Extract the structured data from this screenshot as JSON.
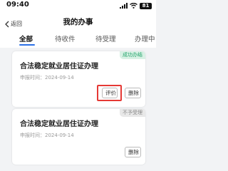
{
  "status_bar": {
    "time": "09:40",
    "battery": "81",
    "icons": [
      "signal-icon",
      "wifi-icon",
      "battery-icon"
    ]
  },
  "nav": {
    "back_label": "返回",
    "title": "我的办事"
  },
  "tabs": [
    {
      "label": "全部",
      "active": true
    },
    {
      "label": "待收件",
      "active": false
    },
    {
      "label": "待受理",
      "active": false
    },
    {
      "label": "办理中",
      "active": false
    }
  ],
  "cards": [
    {
      "status": "成功办结",
      "title": "合法稳定就业居住证办理",
      "date_label": "申报时间：",
      "date": "2024-09-14",
      "review_label": "评价",
      "delete_label": "删除"
    },
    {
      "status": "不予受理",
      "title": "合法稳定就业居住证办理",
      "date_label": "申报时间：",
      "date": "2024-09-14",
      "delete_label": "删除"
    }
  ],
  "colors": {
    "accent": "#2b6fe6",
    "success": "#23a36b",
    "highlight": "#e53935"
  }
}
